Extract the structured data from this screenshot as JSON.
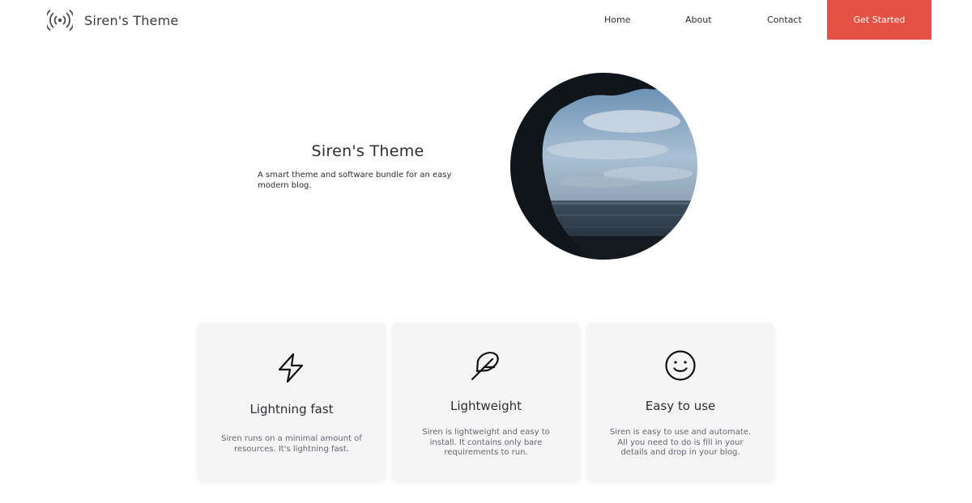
{
  "header": {
    "logo_text": "Siren's Theme",
    "logo_icon": "broadcast-icon",
    "nav": {
      "home": "Home",
      "about": "About",
      "contact": "Contact"
    },
    "cta_label": "Get Started",
    "cta_color": "#e55143"
  },
  "hero": {
    "title": "Siren's Theme",
    "subtitle": "A smart theme and software bundle for an easy modern blog.",
    "image": "sea-cave-ocean-photo"
  },
  "features": [
    {
      "icon": "lightning-icon",
      "title": "Lightning fast",
      "description": "Siren runs on a minimal amount of resources. It's lightning fast."
    },
    {
      "icon": "feather-icon",
      "title": "Lightweight",
      "description": "Siren is lightweight and easy to install. It contains only bare requirements to run."
    },
    {
      "icon": "smile-icon",
      "title": "Easy to use",
      "description": "Siren is easy to use and automate. All you need to do is fill in your details and drop in your blog."
    }
  ]
}
